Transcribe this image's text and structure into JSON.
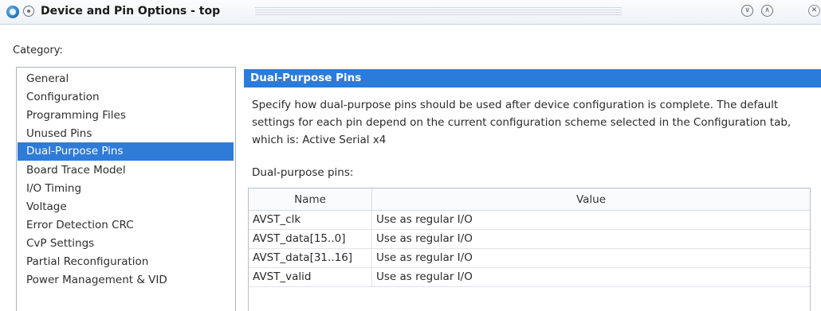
{
  "window": {
    "title": "Device and Pin Options - top"
  },
  "category_label": "Category:",
  "categories": [
    {
      "label": "General",
      "selected": false
    },
    {
      "label": "Configuration",
      "selected": false
    },
    {
      "label": "Programming Files",
      "selected": false
    },
    {
      "label": "Unused Pins",
      "selected": false
    },
    {
      "label": "Dual-Purpose Pins",
      "selected": true
    },
    {
      "label": "Board Trace Model",
      "selected": false
    },
    {
      "label": "I/O Timing",
      "selected": false
    },
    {
      "label": "Voltage",
      "selected": false
    },
    {
      "label": "Error Detection CRC",
      "selected": false
    },
    {
      "label": "CvP Settings",
      "selected": false
    },
    {
      "label": "Partial Reconfiguration",
      "selected": false
    },
    {
      "label": "Power Management & VID",
      "selected": false
    }
  ],
  "panel": {
    "header": "Dual-Purpose Pins",
    "description": "Specify how dual-purpose pins should be used after device configuration is complete. The default settings for each pin depend on the current configuration scheme selected in the Configuration tab, which is:  Active Serial x4",
    "pins_label": "Dual-purpose pins:",
    "table": {
      "columns": [
        "Name",
        "Value"
      ],
      "rows": [
        {
          "name": "AVST_clk",
          "value": "Use as regular I/O"
        },
        {
          "name": "AVST_data[15..0]",
          "value": "Use as regular I/O"
        },
        {
          "name": "AVST_data[31..16]",
          "value": "Use as regular I/O"
        },
        {
          "name": "AVST_valid",
          "value": "Use as regular I/O"
        }
      ]
    }
  },
  "colors": {
    "selection": "#2f7bd8",
    "panel_header": "#2a7bdc"
  }
}
